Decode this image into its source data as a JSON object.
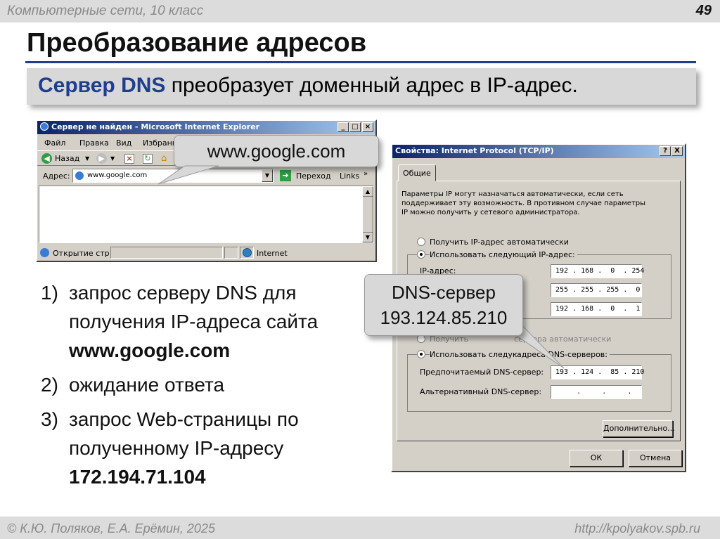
{
  "slide": {
    "course": "Компьютерные сети, 10 класс",
    "page_number": "49",
    "title": "Преобразование адресов",
    "lead_highlight": "Сервер DNS",
    "lead_rest": " преобразует доменный адрес в IP-адрес.",
    "authors": "© К.Ю. Поляков, Е.А. Ерёмин, 2025",
    "site": "http://kpolyakov.spb.ru"
  },
  "browser": {
    "title": "Сервер не найден - Microsoft Internet Explorer",
    "menu": [
      "Файл",
      "Правка",
      "Вид",
      "Избранн"
    ],
    "back_label": "Назад",
    "address_label": "Адрес:",
    "address_value": "www.google.com",
    "go_label": "Переход",
    "links_label": "Links",
    "status_text": "Открытие стр",
    "zone_text": "Internet"
  },
  "callouts": {
    "domain": "www.google.com",
    "dns_line1": "DNS-сервер",
    "dns_line2": "193.124.85.210"
  },
  "dialog": {
    "title": "Свойства: Internet Protocol (TCP/IP)",
    "help_btn": "?",
    "close_btn": "X",
    "tab": "Общие",
    "description": [
      "Параметры IP могут назначаться автоматически, если сеть",
      "поддерживает эту возможность. В противном случае параметры",
      "IP можно получить у сетевого администратора."
    ],
    "radio_auto_ip": "Получить IP-адрес автоматически",
    "radio_manual_ip": "Использовать следующий IP-адрес:",
    "ip_label": "IP-адрес:",
    "ip_value": "192 . 168 .  0  . 254",
    "mask_value": "255 . 255 . 255 .  0",
    "gateway_value": "192 . 168 .  0  .  1",
    "radio_auto_dns_visible": "Получить",
    "radio_auto_dns_tail": "сервера автоматически",
    "radio_manual_dns_head": "Использовать следую",
    "radio_manual_dns_tail": "адреса DNS-серверов:",
    "preferred_dns_label": "Предпочитаемый DNS-сервер:",
    "preferred_dns_value": "193 . 124 .  85 . 210",
    "alternate_dns_label": "Альтернативный DNS-сервер:",
    "alternate_dns_value": "     .     .     .",
    "advanced_btn": "Дополнительно...",
    "ok_btn": "ОК",
    "cancel_btn": "Отмена"
  },
  "steps": {
    "s1_num": "1)",
    "s1_line1": "запрос серверу DNS для",
    "s1_line2": "получения IP-адреса сайта",
    "s1_line3": "www.google.com",
    "s2_num": "2)",
    "s2_text": "ожидание ответа",
    "s3_num": "3)",
    "s3_line1": "запрос Web-страницы по",
    "s3_line2": "полученному IP-адресу",
    "s3_line3": "172.194.71.104"
  },
  "colors": {
    "accent": "#1f3e8e",
    "bar_gray": "#dcdcdc",
    "window_face": "#d4d0c8",
    "titlebar_start": "#0a246a",
    "titlebar_end": "#a6caf0"
  }
}
